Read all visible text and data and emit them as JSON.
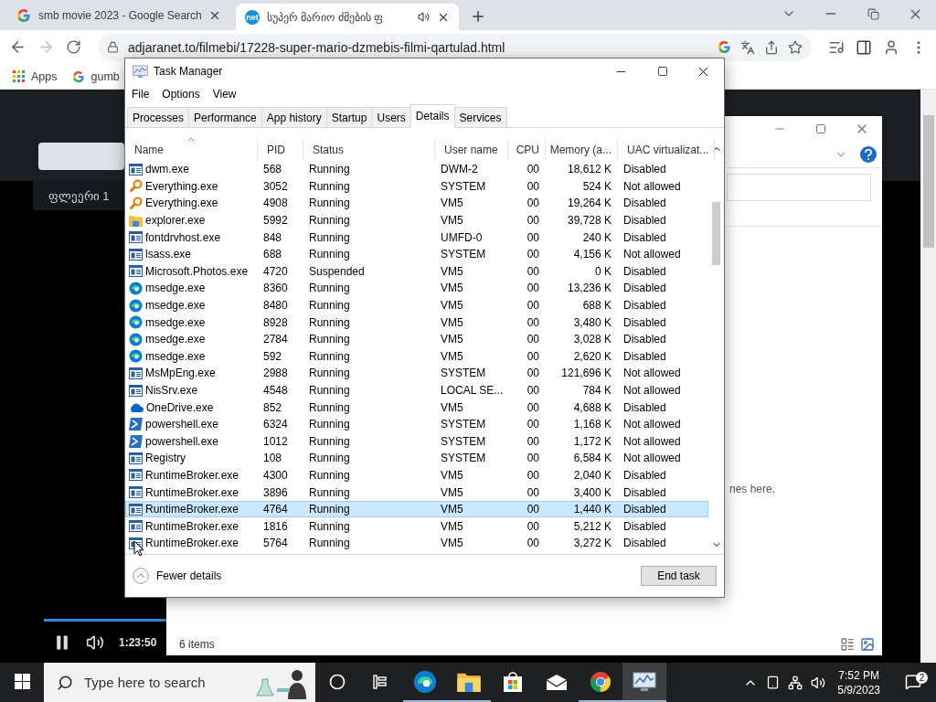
{
  "browser": {
    "tabs": [
      {
        "title": "smb movie 2023 - Google Search",
        "kind": "google",
        "audio": false,
        "selected": false
      },
      {
        "title": "სუპერ მარიო ძმების ფ",
        "kind": "net",
        "audio": true,
        "selected": true
      }
    ],
    "url": "adjaranet.to/filmebi/17228-super-mario-dzmebis-filmi-qartulad.html",
    "bookmarks": [
      {
        "kind": "apps",
        "label": "Apps"
      },
      {
        "kind": "google",
        "label": "gumb"
      }
    ]
  },
  "page": {
    "player_tab": "ფლეერი 1",
    "progress": {
      "level": 0.15
    },
    "time": "1:23:50"
  },
  "dialog": {
    "message": "nes here.",
    "item_count": "6 items"
  },
  "task_manager": {
    "title": "Task Manager",
    "menu": [
      "File",
      "Options",
      "View"
    ],
    "tabs": [
      {
        "label": "Processes",
        "selected": false
      },
      {
        "label": "Performance",
        "selected": false
      },
      {
        "label": "App history",
        "selected": false
      },
      {
        "label": "Startup",
        "selected": false
      },
      {
        "label": "Users",
        "selected": false
      },
      {
        "label": "Details",
        "selected": true
      },
      {
        "label": "Services",
        "selected": false
      }
    ],
    "columns": [
      {
        "label": "Name",
        "sorted": true
      },
      {
        "label": "PID",
        "sorted": false
      },
      {
        "label": "Status",
        "sorted": false
      },
      {
        "label": "User name",
        "sorted": false
      },
      {
        "label": "CPU",
        "sorted": false
      },
      {
        "label": "Memory (a...",
        "sorted": false
      },
      {
        "label": "UAC virtualizat...",
        "sorted": false
      }
    ],
    "rows": [
      {
        "kind": "exe",
        "name": "dwm.exe",
        "pid": "568",
        "status": "Running",
        "user": "DWM-2",
        "cpu": "00",
        "memory": "18,612 K",
        "uac": "Disabled",
        "selected": false
      },
      {
        "kind": "magnifier",
        "name": "Everything.exe",
        "pid": "3052",
        "status": "Running",
        "user": "SYSTEM",
        "cpu": "00",
        "memory": "524 K",
        "uac": "Not allowed",
        "selected": false
      },
      {
        "kind": "magnifier",
        "name": "Everything.exe",
        "pid": "4908",
        "status": "Running",
        "user": "VM5",
        "cpu": "00",
        "memory": "19,264 K",
        "uac": "Disabled",
        "selected": false
      },
      {
        "kind": "folder",
        "name": "explorer.exe",
        "pid": "5992",
        "status": "Running",
        "user": "VM5",
        "cpu": "00",
        "memory": "39,728 K",
        "uac": "Disabled",
        "selected": false
      },
      {
        "kind": "exe",
        "name": "fontdrvhost.exe",
        "pid": "848",
        "status": "Running",
        "user": "UMFD-0",
        "cpu": "00",
        "memory": "240 K",
        "uac": "Disabled",
        "selected": false
      },
      {
        "kind": "exe",
        "name": "lsass.exe",
        "pid": "688",
        "status": "Running",
        "user": "SYSTEM",
        "cpu": "00",
        "memory": "4,156 K",
        "uac": "Not allowed",
        "selected": false
      },
      {
        "kind": "exe",
        "name": "Microsoft.Photos.exe",
        "pid": "4720",
        "status": "Suspended",
        "user": "VM5",
        "cpu": "00",
        "memory": "0 K",
        "uac": "Disabled",
        "selected": false
      },
      {
        "kind": "edge",
        "name": "msedge.exe",
        "pid": "8360",
        "status": "Running",
        "user": "VM5",
        "cpu": "00",
        "memory": "13,236 K",
        "uac": "Disabled",
        "selected": false
      },
      {
        "kind": "edge",
        "name": "msedge.exe",
        "pid": "8480",
        "status": "Running",
        "user": "VM5",
        "cpu": "00",
        "memory": "688 K",
        "uac": "Disabled",
        "selected": false
      },
      {
        "kind": "edge",
        "name": "msedge.exe",
        "pid": "8928",
        "status": "Running",
        "user": "VM5",
        "cpu": "00",
        "memory": "3,480 K",
        "uac": "Disabled",
        "selected": false
      },
      {
        "kind": "edge",
        "name": "msedge.exe",
        "pid": "2784",
        "status": "Running",
        "user": "VM5",
        "cpu": "00",
        "memory": "3,028 K",
        "uac": "Disabled",
        "selected": false
      },
      {
        "kind": "edge",
        "name": "msedge.exe",
        "pid": "592",
        "status": "Running",
        "user": "VM5",
        "cpu": "00",
        "memory": "2,620 K",
        "uac": "Disabled",
        "selected": false
      },
      {
        "kind": "exe",
        "name": "MsMpEng.exe",
        "pid": "2988",
        "status": "Running",
        "user": "SYSTEM",
        "cpu": "00",
        "memory": "121,696 K",
        "uac": "Not allowed",
        "selected": false
      },
      {
        "kind": "exe",
        "name": "NisSrv.exe",
        "pid": "4548",
        "status": "Running",
        "user": "LOCAL SE...",
        "cpu": "00",
        "memory": "784 K",
        "uac": "Not allowed",
        "selected": false
      },
      {
        "kind": "cloud",
        "name": "OneDrive.exe",
        "pid": "852",
        "status": "Running",
        "user": "VM5",
        "cpu": "00",
        "memory": "4,688 K",
        "uac": "Disabled",
        "selected": false
      },
      {
        "kind": "shell",
        "name": "powershell.exe",
        "pid": "6324",
        "status": "Running",
        "user": "SYSTEM",
        "cpu": "00",
        "memory": "1,168 K",
        "uac": "Not allowed",
        "selected": false
      },
      {
        "kind": "shell",
        "name": "powershell.exe",
        "pid": "1012",
        "status": "Running",
        "user": "SYSTEM",
        "cpu": "00",
        "memory": "1,172 K",
        "uac": "Not allowed",
        "selected": false
      },
      {
        "kind": "exe",
        "name": "Registry",
        "pid": "108",
        "status": "Running",
        "user": "SYSTEM",
        "cpu": "00",
        "memory": "6,584 K",
        "uac": "Not allowed",
        "selected": false
      },
      {
        "kind": "exe",
        "name": "RuntimeBroker.exe",
        "pid": "4300",
        "status": "Running",
        "user": "VM5",
        "cpu": "00",
        "memory": "2,040 K",
        "uac": "Disabled",
        "selected": false
      },
      {
        "kind": "exe",
        "name": "RuntimeBroker.exe",
        "pid": "3896",
        "status": "Running",
        "user": "VM5",
        "cpu": "00",
        "memory": "3,400 K",
        "uac": "Disabled",
        "selected": false
      },
      {
        "kind": "exe",
        "name": "RuntimeBroker.exe",
        "pid": "4764",
        "status": "Running",
        "user": "VM5",
        "cpu": "00",
        "memory": "1,440 K",
        "uac": "Disabled",
        "selected": true
      },
      {
        "kind": "exe",
        "name": "RuntimeBroker.exe",
        "pid": "1816",
        "status": "Running",
        "user": "VM5",
        "cpu": "00",
        "memory": "5,212 K",
        "uac": "Disabled",
        "selected": false
      },
      {
        "kind": "exe",
        "name": "RuntimeBroker.exe",
        "pid": "5764",
        "status": "Running",
        "user": "VM5",
        "cpu": "00",
        "memory": "3,272 K",
        "uac": "Disabled",
        "selected": false
      }
    ],
    "fewer_details": "Fewer details",
    "end_task": "End task"
  },
  "taskbar": {
    "search_placeholder": "Type here to search",
    "apps": [
      {
        "kind": "cortana",
        "running": false,
        "active": false
      },
      {
        "kind": "taskview",
        "running": false,
        "active": false
      },
      {
        "kind": "edge",
        "running": true,
        "active": false
      },
      {
        "kind": "folder",
        "running": true,
        "active": false
      },
      {
        "kind": "store",
        "running": false,
        "active": false
      },
      {
        "kind": "mail",
        "running": false,
        "active": false
      },
      {
        "kind": "chrome",
        "running": true,
        "active": false
      },
      {
        "kind": "taskmgr",
        "running": true,
        "active": true
      }
    ],
    "time": "7:52 PM",
    "date": "5/9/2023",
    "notifications": "2"
  }
}
